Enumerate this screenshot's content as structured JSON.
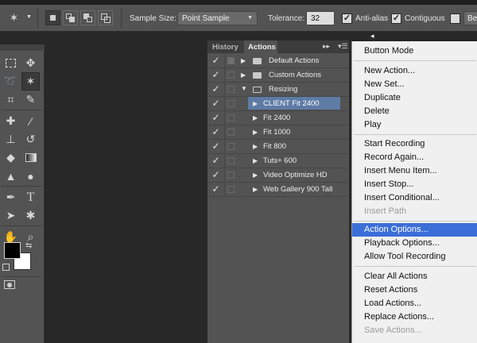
{
  "options_bar": {
    "sample_size_label": "Sample Size:",
    "sample_size_value": "Point Sample",
    "tolerance_label": "Tolerance:",
    "tolerance_value": "32",
    "anti_alias_label": "Anti-alias",
    "contiguous_label": "Contiguous",
    "cut_off_label": "Ber"
  },
  "panel": {
    "tabs": [
      "History",
      "Actions"
    ],
    "active_tab": "Actions",
    "rows": [
      {
        "label": "Default Actions",
        "type": "set",
        "expanded": false
      },
      {
        "label": "Custom Actions",
        "type": "set",
        "expanded": false
      },
      {
        "label": "Resizing",
        "type": "set",
        "expanded": true
      },
      {
        "label": "CLIENT Fit 2400",
        "type": "action",
        "selected": true
      },
      {
        "label": "Fit 2400",
        "type": "action"
      },
      {
        "label": "Fit 1000",
        "type": "action"
      },
      {
        "label": "Fit 800",
        "type": "action"
      },
      {
        "label": "Tuts+ 600",
        "type": "action"
      },
      {
        "label": "Video Optimize HD",
        "type": "action"
      },
      {
        "label": "Web Gallery 900 Tall",
        "type": "action"
      }
    ]
  },
  "menu": {
    "groups": [
      [
        {
          "label": "Button Mode"
        }
      ],
      [
        {
          "label": "New Action..."
        },
        {
          "label": "New Set..."
        },
        {
          "label": "Duplicate"
        },
        {
          "label": "Delete"
        },
        {
          "label": "Play"
        }
      ],
      [
        {
          "label": "Start Recording"
        },
        {
          "label": "Record Again..."
        },
        {
          "label": "Insert Menu Item..."
        },
        {
          "label": "Insert Stop..."
        },
        {
          "label": "Insert Conditional..."
        },
        {
          "label": "Insert Path",
          "disabled": true
        }
      ],
      [
        {
          "label": "Action Options...",
          "highlighted": true
        },
        {
          "label": "Playback Options..."
        },
        {
          "label": "Allow Tool Recording"
        }
      ],
      [
        {
          "label": "Clear All Actions"
        },
        {
          "label": "Reset Actions"
        },
        {
          "label": "Load Actions..."
        },
        {
          "label": "Replace Actions..."
        },
        {
          "label": "Save Actions...",
          "disabled": true
        }
      ]
    ]
  },
  "colors": {
    "highlight": "#3b6fd8",
    "selected_row": "#5e7ba5",
    "foreground_swatch": "#000000",
    "background_swatch": "#ffffff"
  },
  "icons": {
    "tools": [
      "marquee-icon",
      "move-icon",
      "lasso-icon",
      "magic-wand-icon",
      "crop-icon",
      "eyedropper-icon",
      "healing-brush-icon",
      "brush-icon",
      "clone-stamp-icon",
      "history-brush-icon",
      "eraser-icon",
      "gradient-icon",
      "blur-icon",
      "dodge-icon",
      "pen-icon",
      "type-icon",
      "path-selection-icon",
      "shape-icon",
      "hand-icon",
      "zoom-icon"
    ]
  }
}
